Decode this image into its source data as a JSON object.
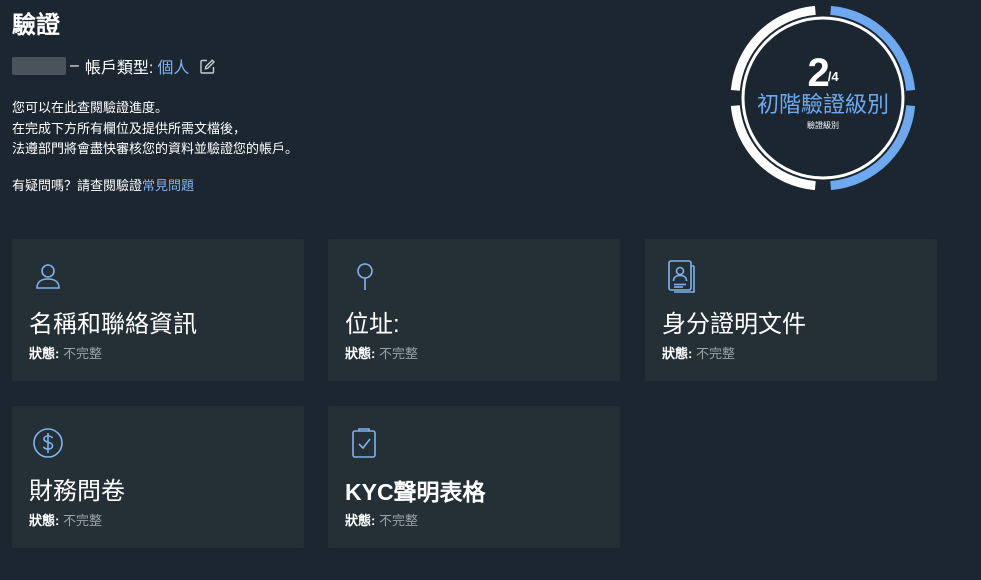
{
  "header": {
    "title": "驗證",
    "account_separator": "–",
    "account_type_label": "帳戶類型:",
    "account_type_value": "個人",
    "description": [
      "您可以在此查閱驗證進度。",
      "在完成下方所有欄位及提供所需文檔後，",
      "法遵部門將會盡快審核您的資料並驗證您的帳戶。"
    ],
    "faq_prefix": "有疑問嗎？請查閱驗證",
    "faq_link": "常見問題"
  },
  "level": {
    "current": "2",
    "total": "/4",
    "name": "初階驗證級別",
    "sublabel": "驗證級別",
    "progress_fraction": 0.5,
    "accent_color": "#6ea9ef"
  },
  "cards": [
    {
      "icon": "user-icon",
      "title": "名稱和聯絡資訊",
      "status_label": "狀態:",
      "status_value": "不完整"
    },
    {
      "icon": "location-pin-icon",
      "title": "位址:",
      "status_label": "狀態:",
      "status_value": "不完整"
    },
    {
      "icon": "id-document-icon",
      "title": "身分證明文件",
      "status_label": "狀態:",
      "status_value": "不完整"
    },
    {
      "icon": "dollar-circle-icon",
      "title": "財務問卷",
      "status_label": "狀態:",
      "status_value": "不完整"
    },
    {
      "icon": "clipboard-check-icon",
      "title": "KYC聲明表格",
      "status_label": "狀態:",
      "status_value": "不完整"
    }
  ]
}
